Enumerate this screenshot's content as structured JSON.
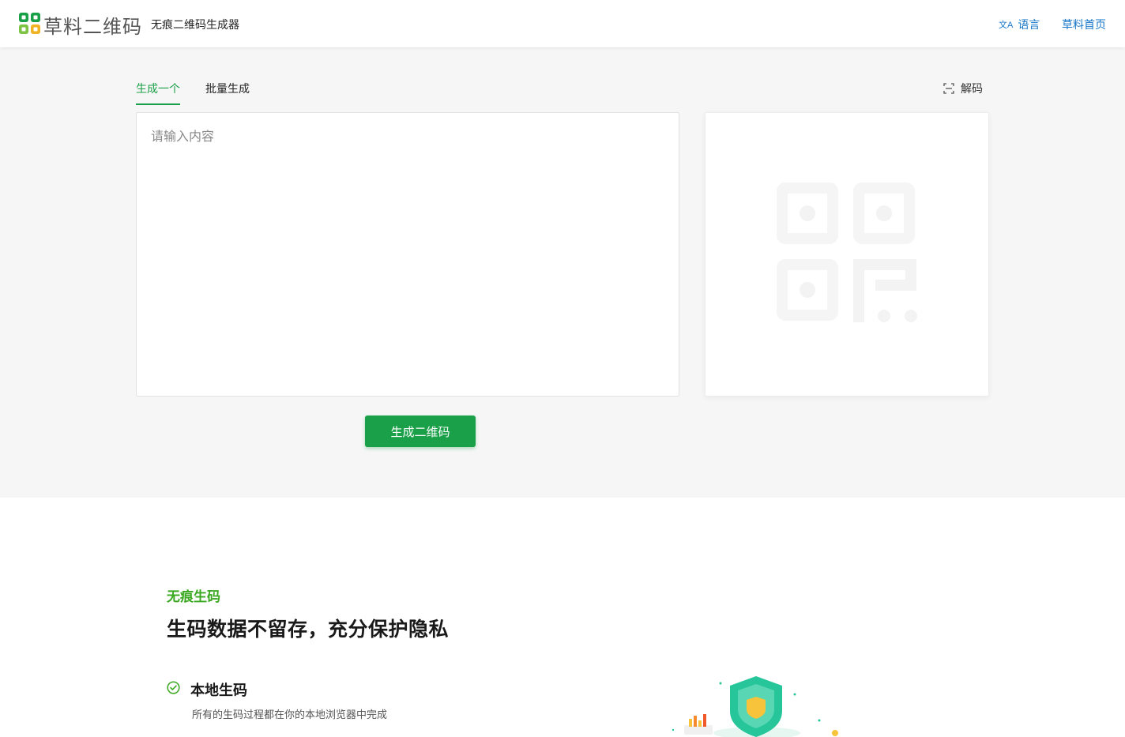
{
  "header": {
    "brand": "草料二维码",
    "subtitle": "无痕二维码生成器",
    "language_label": "语言",
    "language_icon": "translate-icon",
    "home_link": "草料首页"
  },
  "tabs": [
    {
      "label": "生成一个",
      "active": true
    },
    {
      "label": "批量生成",
      "active": false
    }
  ],
  "decode": {
    "label": "解码",
    "icon": "scan-icon"
  },
  "editor": {
    "placeholder": "请输入内容",
    "value": ""
  },
  "generate_button": "生成二维码",
  "colors": {
    "accent": "#1aa048",
    "link": "#1677c9",
    "tag": "#3aa820",
    "hero_bg": "#f6f6f6"
  },
  "feature": {
    "tag": "无痕生码",
    "title": "生码数据不留存，充分保护隐私",
    "items": [
      {
        "icon": "check-circle-icon",
        "title": "本地生码",
        "desc": "所有的生码过程都在你的本地浏览器中完成"
      }
    ]
  }
}
